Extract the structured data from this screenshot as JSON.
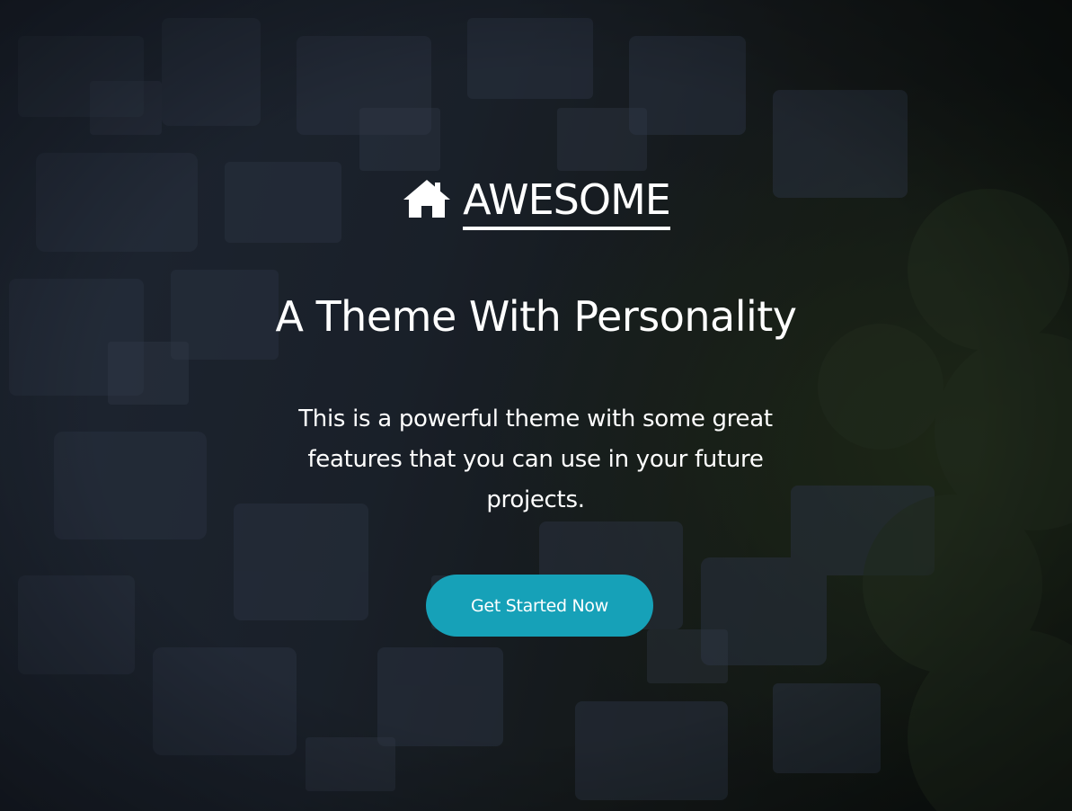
{
  "brand": {
    "icon": "home-icon",
    "name": "AWESOME"
  },
  "hero": {
    "headline": "A Theme With Personality",
    "tagline": "This is a powerful theme with some great features that you can use in your future projects.",
    "cta_label": "Get Started Now"
  },
  "colors": {
    "cta_background": "#16a1b8",
    "text": "#ffffff",
    "overlay": "#0a1018"
  }
}
